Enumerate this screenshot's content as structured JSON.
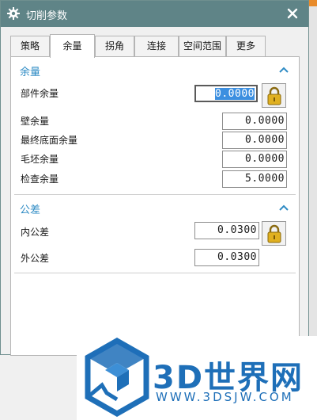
{
  "dialog": {
    "title": "切削参数",
    "icons": {
      "title": "gear-icon",
      "close": "close-icon"
    }
  },
  "tabs": [
    {
      "label": "策略"
    },
    {
      "label": "余量",
      "active": true
    },
    {
      "label": "拐角"
    },
    {
      "label": "连接"
    },
    {
      "label": "空间范围"
    },
    {
      "label": "更多"
    }
  ],
  "allowance": {
    "title": "余量",
    "fields": [
      {
        "label": "部件余量",
        "value": "0.0000",
        "selected": true,
        "locked": true
      },
      {
        "label": "壁余量",
        "value": "0.0000"
      },
      {
        "label": "最终底面余量",
        "value": "0.0000"
      },
      {
        "label": "毛坯余量",
        "value": "0.0000"
      },
      {
        "label": "检查余量",
        "value": "5.0000"
      }
    ]
  },
  "tolerance": {
    "title": "公差",
    "fields": [
      {
        "label": "内公差",
        "value": "0.0300",
        "locked": true
      },
      {
        "label": "外公差",
        "value": "0.0300"
      }
    ]
  },
  "watermark": {
    "brand": "3D世界网",
    "url": "WWW.3DSJW.COM"
  },
  "colors": {
    "titlebar": "#5f8487",
    "section_title": "#2e8bc4",
    "selection": "#3c8fe0",
    "lock": "#e0b020"
  }
}
